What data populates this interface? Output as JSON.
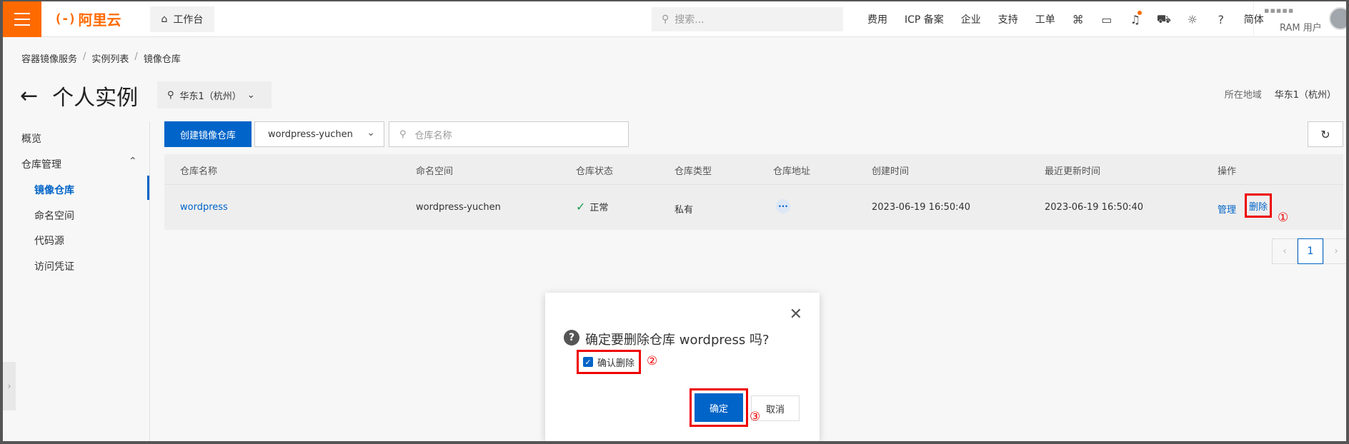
{
  "topbar": {
    "brand": "阿里云",
    "brand_mark": "(-)",
    "workbench": "工作台",
    "search_placeholder": "搜索...",
    "links": [
      "费用",
      "ICP 备案",
      "企业",
      "支持",
      "工单"
    ],
    "lang": "简体",
    "user_name": "▪▪▪▪▪",
    "user_role": "RAM 用户"
  },
  "breadcrumb": [
    "容器镜像服务",
    "实例列表",
    "镜像仓库"
  ],
  "page": {
    "title": "个人实例",
    "region": "华东1（杭州）",
    "region_label": "所在地域",
    "region_value": "华东1（杭州）"
  },
  "sidebar": {
    "overview": "概览",
    "repo_mgmt": "仓库管理",
    "items": [
      "镜像仓库",
      "命名空间",
      "代码源",
      "访问凭证"
    ]
  },
  "toolbar": {
    "create_label": "创建镜像仓库",
    "namespace": "wordpress-yuchen",
    "search_placeholder": "仓库名称"
  },
  "table": {
    "headers": [
      "仓库名称",
      "命名空间",
      "仓库状态",
      "仓库类型",
      "仓库地址",
      "创建时间",
      "最近更新时间",
      "操作"
    ],
    "rows": [
      {
        "name": "wordpress",
        "namespace": "wordpress-yuchen",
        "status": "正常",
        "type": "私有",
        "address": "···",
        "created": "2023-06-19 16:50:40",
        "updated": "2023-06-19 16:50:40",
        "manage": "管理",
        "delete": "删除"
      }
    ]
  },
  "pagination": {
    "current": "1"
  },
  "annotations": {
    "step1": "①",
    "step2": "②",
    "step3": "③"
  },
  "modal": {
    "message": "确定要删除仓库 wordpress 吗?",
    "checkbox_label": "确认删除",
    "ok": "确定",
    "cancel": "取消"
  },
  "colors": {
    "brand": "#ff6a00",
    "primary": "#0064c8",
    "highlight": "#e00000",
    "success": "#1e9b4f"
  }
}
